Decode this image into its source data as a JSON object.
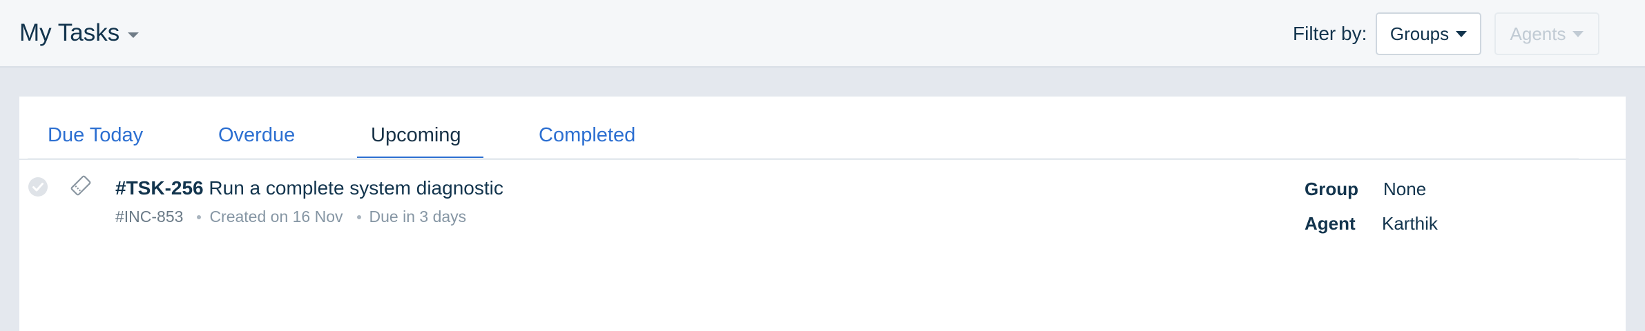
{
  "header": {
    "title": "My Tasks",
    "filter_label": "Filter by:",
    "groups_button": "Groups",
    "agents_button": "Agents"
  },
  "tabs": [
    {
      "label": "Due Today",
      "active": false
    },
    {
      "label": "Overdue",
      "active": false
    },
    {
      "label": "Upcoming",
      "active": true
    },
    {
      "label": "Completed",
      "active": false
    }
  ],
  "tasks": [
    {
      "id": "#TSK-256",
      "title": "Run a complete system diagnostic",
      "incident": "#INC-853",
      "created": "Created on 16 Nov",
      "due": "Due in 3 days",
      "group_label": "Group",
      "group_value": "None",
      "agent_label": "Agent",
      "agent_value": "Karthik"
    }
  ],
  "icons": {
    "complete": "check-circle-icon",
    "type": "ticket-tag-icon"
  },
  "colors": {
    "link": "#2c6fd1",
    "text": "#12344d",
    "muted": "#8696a4"
  }
}
